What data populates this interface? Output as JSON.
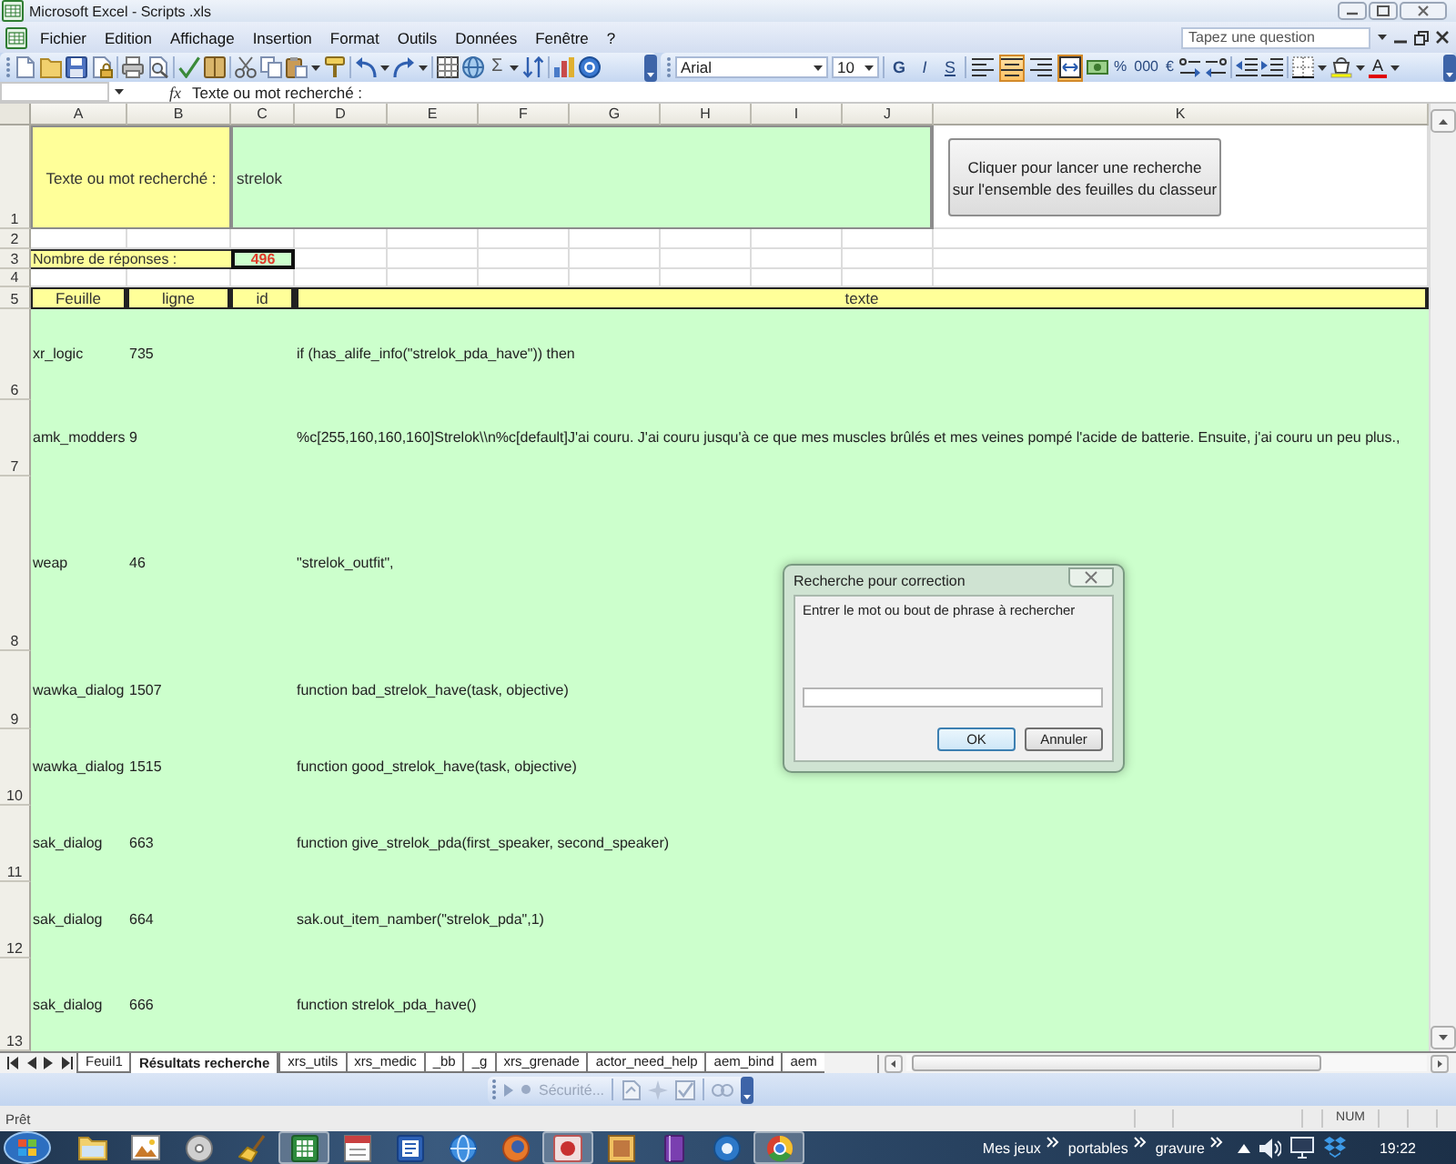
{
  "window": {
    "title": "Microsoft Excel - Scripts .xls"
  },
  "menu_bar": {
    "items": [
      "Fichier",
      "Edition",
      "Affichage",
      "Insertion",
      "Format",
      "Outils",
      "Données",
      "Fenêtre",
      "?"
    ],
    "help_search": {
      "placeholder": "Tapez une question"
    }
  },
  "toolbar": {
    "autosum": "Σ",
    "font": "Arial",
    "font_size": "10",
    "style_buttons": [
      "G",
      "I",
      "S"
    ],
    "alignment": [
      {
        "kind": "left",
        "selected": false
      },
      {
        "kind": "center",
        "selected": true
      },
      {
        "kind": "right",
        "selected": false
      },
      {
        "kind": "merge",
        "selected": true
      }
    ],
    "number_buttons": [
      "%",
      "000",
      "€"
    ],
    "font_color_button": "A"
  },
  "formula_bar": {
    "function_label": "fx",
    "content": "Texte ou mot recherché :"
  },
  "sheet": {
    "columns": [
      "A",
      "B",
      "C",
      "D",
      "E",
      "F",
      "G",
      "H",
      "I",
      "J",
      "K"
    ],
    "row_numbers": [
      "1",
      "2",
      "3",
      "4",
      "5",
      "6",
      "7",
      "8",
      "9",
      "10",
      "11",
      "12",
      "13"
    ],
    "search_label": "Texte ou mot recherché :",
    "search_value": "strelok",
    "search_button": [
      "Cliquer pour lancer une recherche",
      "sur l'ensemble des feuilles du classeur"
    ],
    "count_label": "Nombre de réponses :",
    "count_value": "496",
    "results": {
      "columns": [
        "Feuille",
        "ligne",
        "id",
        "texte"
      ],
      "rows": [
        {
          "sheet": "xr_logic",
          "line": "735",
          "text": "if (has_alife_info(\"strelok_pda_have\")) then"
        },
        {
          "sheet": "amk_modders",
          "line": "9",
          "text": "%c[255,160,160,160]Strelok\\\\n%c[default]J'ai couru. J'ai couru jusqu'à ce que mes muscles brûlés et mes veines pompé l'acide de batterie. Ensuite, j'ai couru un peu plus.,"
        },
        {
          "sheet": "weap",
          "line": "46",
          "text": "\"strelok_outfit\","
        },
        {
          "sheet": "wawka_dialog",
          "line": "1507",
          "text": "function bad_strelok_have(task, objective)"
        },
        {
          "sheet": "wawka_dialog",
          "line": "1515",
          "text": "function good_strelok_have(task, objective)"
        },
        {
          "sheet": "sak_dialog",
          "line": "663",
          "text": "function give_strelok_pda(first_speaker, second_speaker)"
        },
        {
          "sheet": "sak_dialog",
          "line": "664",
          "text": "sak.out_item_namber(\"strelok_pda\",1)"
        },
        {
          "sheet": "sak_dialog",
          "line": "666",
          "text": "function strelok_pda_have()"
        }
      ]
    }
  },
  "dialog": {
    "title": "Recherche pour correction",
    "prompt": "Entrer le mot ou bout de phrase à rechercher",
    "buttons": [
      {
        "label": "OK",
        "default": true
      },
      {
        "label": "Annuler",
        "default": false
      }
    ]
  },
  "sheet_tabs": [
    {
      "label": "Feuil1",
      "selected": false
    },
    {
      "label": "Résultats recherche",
      "selected": true
    },
    {
      "label": "xrs_utils",
      "selected": false
    },
    {
      "label": "xrs_medic",
      "selected": false
    },
    {
      "label": "_bb",
      "selected": false
    },
    {
      "label": "_g",
      "selected": false
    },
    {
      "label": "xrs_grenade",
      "selected": false
    },
    {
      "label": "actor_need_help",
      "selected": false
    },
    {
      "label": "aem_bind",
      "selected": false
    },
    {
      "label": "aem",
      "selected": false
    }
  ],
  "security_toolbar": {
    "label": "Sécurité...",
    "disabled": true
  },
  "status_bar": {
    "status": "Prêt",
    "indicators": [
      "NUM"
    ]
  },
  "taskbar": {
    "apps": [
      {
        "running": false
      },
      {
        "running": false
      },
      {
        "running": false
      },
      {
        "running": false
      },
      {
        "running": true
      },
      {
        "running": false
      },
      {
        "running": false
      },
      {
        "running": false
      },
      {
        "running": false
      },
      {
        "running": true
      },
      {
        "running": false
      },
      {
        "running": false
      },
      {
        "running": false
      },
      {
        "running": true
      }
    ],
    "toolbars": [
      "Mes jeux",
      "portables",
      "gravure"
    ],
    "clock": "19:22"
  }
}
